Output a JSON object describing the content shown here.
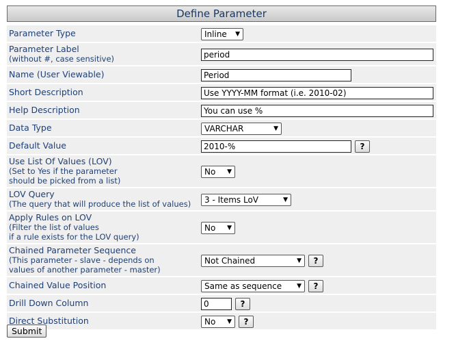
{
  "title": "Define Parameter",
  "rows": {
    "param_type": {
      "label": "Parameter Type",
      "value": "Inline"
    },
    "param_label": {
      "label": "Parameter Label",
      "sub": "(without #, case sensitive)",
      "value": "period"
    },
    "name": {
      "label": "Name (User Viewable)",
      "value": "Period"
    },
    "short_desc": {
      "label": "Short Description",
      "value": "Use YYYY-MM format (i.e. 2010-02)"
    },
    "help_desc": {
      "label": "Help Description",
      "value": "You can use %"
    },
    "data_type": {
      "label": "Data Type",
      "value": "VARCHAR"
    },
    "default_value": {
      "label": "Default Value",
      "value": "2010-%"
    },
    "use_lov": {
      "label": "Use List Of Values (LOV)",
      "sub1": "(Set to Yes if the parameter",
      "sub2": "should be picked from a list)",
      "value": "No"
    },
    "lov_query": {
      "label": "LOV Query",
      "sub": "(The query that will produce the list of values)",
      "value": "3 - Items LoV"
    },
    "apply_rules": {
      "label": "Apply Rules on LOV",
      "sub1": "(Filter the list of values",
      "sub2": "if a rule exists for the LOV query)",
      "value": "No"
    },
    "chained_seq": {
      "label": "Chained Parameter Sequence",
      "sub1": "(This parameter - slave - depends on",
      "sub2": "values of another parameter - master)",
      "value": "Not Chained"
    },
    "chained_pos": {
      "label": "Chained Value Position",
      "value": "Same as sequence"
    },
    "drill_down": {
      "label": "Drill Down Column",
      "value": "0"
    },
    "direct_sub": {
      "label": "Direct Substitution",
      "value": "No"
    }
  },
  "help_button": "?",
  "submit_label": "Submit"
}
